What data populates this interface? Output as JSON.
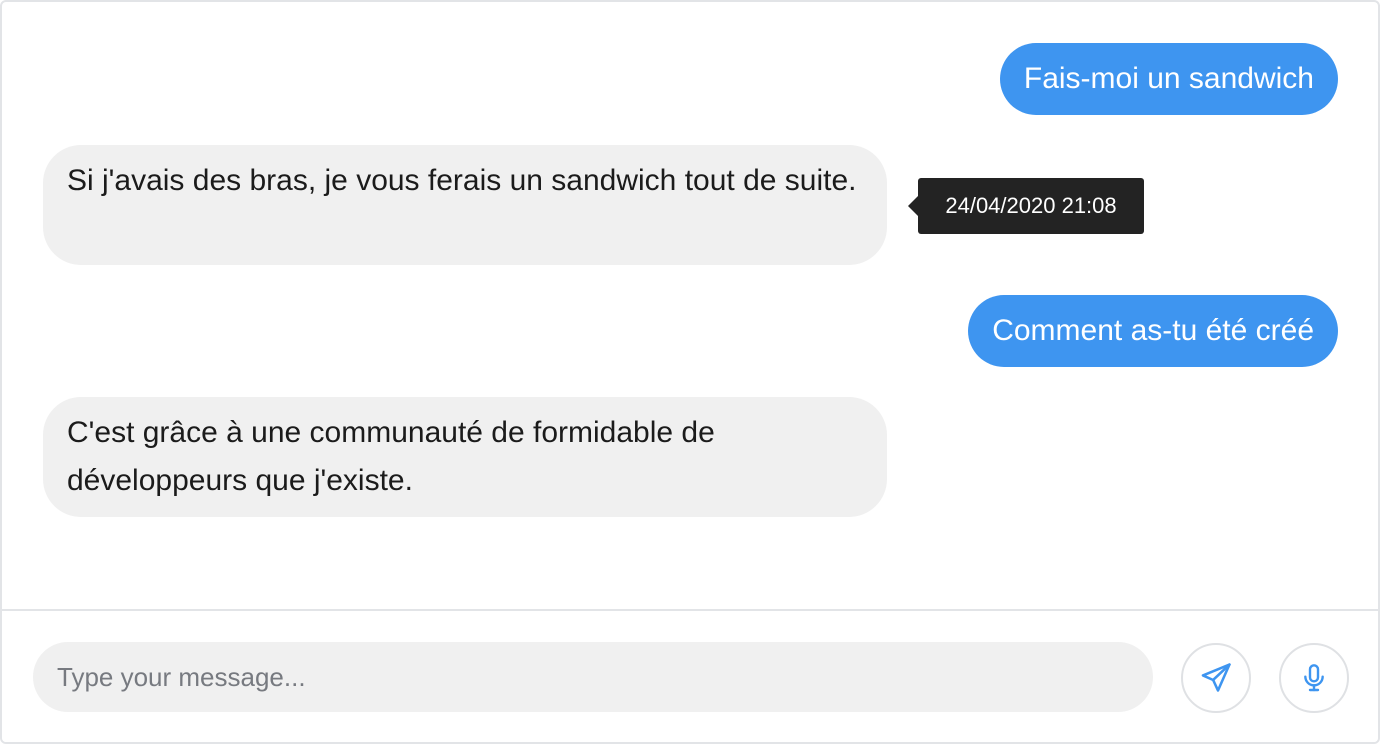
{
  "conversation": {
    "messages": [
      {
        "role": "user",
        "text": "Fais-moi un sandwich"
      },
      {
        "role": "bot",
        "text": "Si j'avais des bras, je vous ferais un sandwich tout de suite."
      },
      {
        "role": "user",
        "text": "Comment as-tu été créé"
      },
      {
        "role": "bot",
        "text": "C'est grâce à une communauté de formidable de développeurs que j'existe."
      }
    ],
    "tooltip": "24/04/2020 21:08"
  },
  "composer": {
    "placeholder": "Type your message...",
    "value": "",
    "send_icon": "paper-plane-icon",
    "mic_icon": "microphone-icon"
  },
  "colors": {
    "user_bubble": "#3e95f0",
    "bot_bubble": "#f0f0f0",
    "tooltip_bg": "#232323",
    "icon_accent": "#3e95f0"
  }
}
